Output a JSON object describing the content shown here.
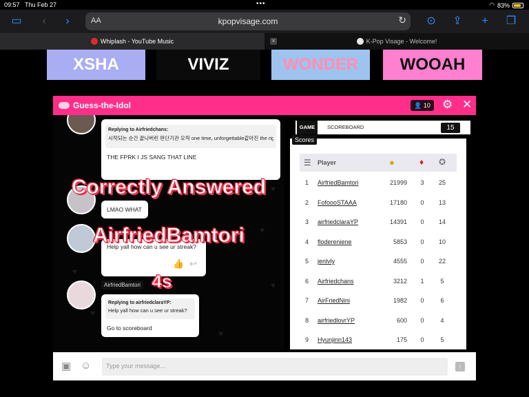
{
  "status": {
    "time": "09:57",
    "date": "Thu Feb 27",
    "battery": "83%",
    "battery_level": 0.83
  },
  "toolbar": {
    "text_size": "AA",
    "url": "kpopvisage.com"
  },
  "tabs": [
    {
      "title": "Whiplash - YouTube Music",
      "active": true
    },
    {
      "title": "K-Pop Visage - Welcome!",
      "active": false
    }
  ],
  "banners": [
    {
      "text": "XSHA",
      "bg": "#a9aef2",
      "color": "#ffffff"
    },
    {
      "text": "VIVIZ",
      "bg": "#0b0b0b",
      "color": "#ffffff"
    },
    {
      "text": "WONDER",
      "bg": "#9ec3ef",
      "color": "#ff8fb3"
    },
    {
      "text": "WOOAH",
      "bg": "#ff7fd0",
      "color": "#111111"
    }
  ],
  "modal": {
    "title": "Guess-the-Idol",
    "player_count": "10",
    "accent": "#ff2e8a"
  },
  "chat": {
    "msg1": {
      "reply_to": "Replying to Airfriedchans:",
      "quote": "시작되는 순간 끝나버린 판단기관 오직 one time, unforgettable같아진 the right",
      "text": "THE FPRK I JS SANG THAT LINE"
    },
    "msg2": {
      "text": "LMAO WHAT"
    },
    "msg3": {
      "text": "Help yall how can u see ur streak?"
    },
    "msg4": {
      "author": "AirfriedBamtori",
      "reply_to": "Replying to airfriedclaraYP:",
      "quote": "Help yall how can u see ur streak?",
      "text": "Go to scoreboard"
    }
  },
  "overlay": {
    "line1": "Correctly Answered",
    "line2": "AirfriedBamtori",
    "line3": "4s"
  },
  "scoreboard": {
    "tab_game": "GAME",
    "tab_scoreboard": "SCOREBOARD",
    "count": "15",
    "scores_label": "Scores",
    "header_player": "Player",
    "rows": [
      {
        "rank": "1",
        "name": "AirfriedBamtori",
        "points": "21999",
        "streak": "3",
        "awards": "25"
      },
      {
        "rank": "2",
        "name": "FofoooSTAAA",
        "points": "17180",
        "streak": "0",
        "awards": "13"
      },
      {
        "rank": "3",
        "name": "airfriedclaraYP",
        "points": "14391",
        "streak": "0",
        "awards": "14"
      },
      {
        "rank": "4",
        "name": "flodereniene",
        "points": "5853",
        "streak": "0",
        "awards": "10"
      },
      {
        "rank": "5",
        "name": "jenlvly",
        "points": "4555",
        "streak": "0",
        "awards": "22"
      },
      {
        "rank": "6",
        "name": "Airfriedchans",
        "points": "3212",
        "streak": "1",
        "awards": "5"
      },
      {
        "rank": "7",
        "name": "AirFriedNini",
        "points": "1982",
        "streak": "0",
        "awards": "6"
      },
      {
        "rank": "8",
        "name": "airfriedlovrYP",
        "points": "600",
        "streak": "0",
        "awards": "4"
      },
      {
        "rank": "9",
        "name": "Hyunjinn143",
        "points": "175",
        "streak": "0",
        "awards": "5"
      }
    ]
  },
  "input": {
    "placeholder": "Type your message..."
  }
}
